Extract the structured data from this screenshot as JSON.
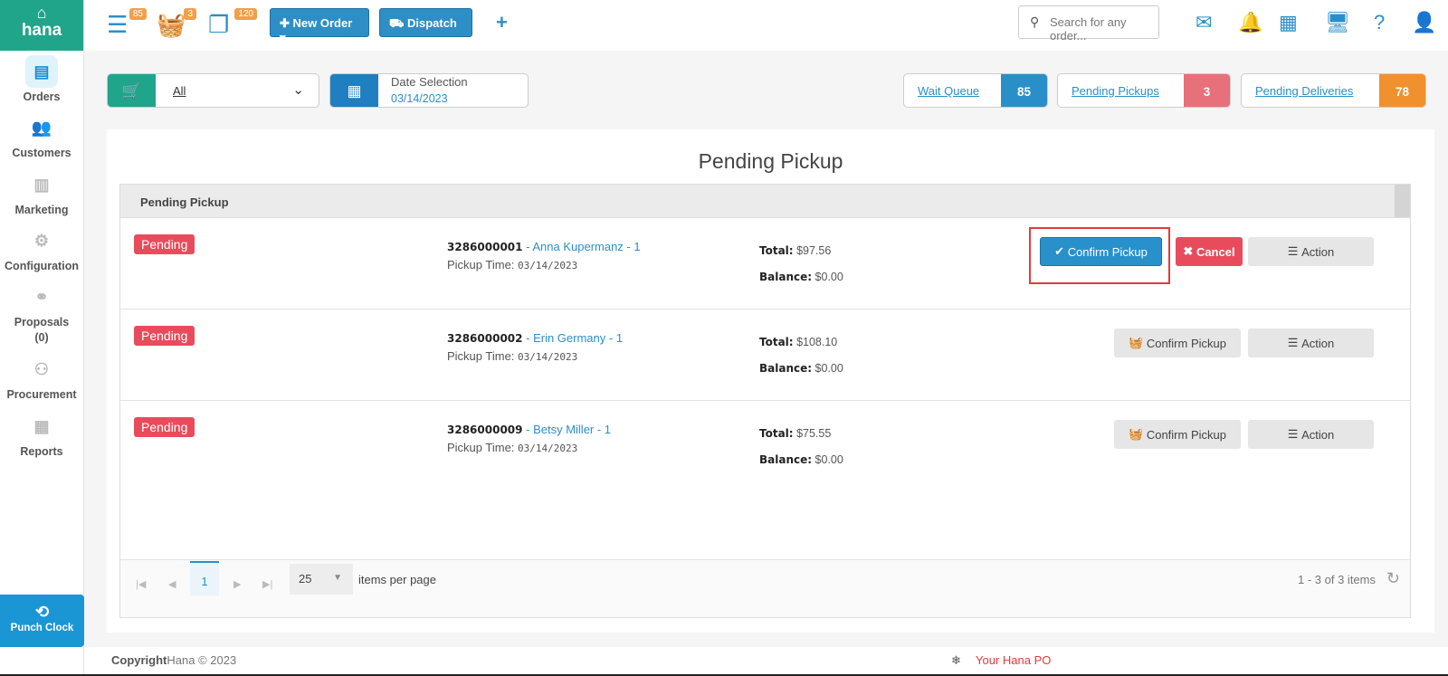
{
  "sidebar": {
    "brand": "hana",
    "items": [
      {
        "label": "Orders"
      },
      {
        "label": "Customers"
      },
      {
        "label": "Marketing"
      },
      {
        "label": "Configuration"
      },
      {
        "label": "Proposals",
        "sub": "(0)"
      },
      {
        "label": "Procurement"
      },
      {
        "label": "Reports"
      }
    ],
    "punch_clock": "Punch Clock"
  },
  "topbar": {
    "badges": {
      "queue": "85",
      "basket": "3",
      "copies": "120"
    },
    "new_order": "New Order",
    "dispatch": "Dispatch",
    "search_placeholder": "Search for any order..."
  },
  "filters": {
    "store": "All",
    "date_label": "Date Selection",
    "date_value": "03/14/2023",
    "counters": [
      {
        "label": "Wait Queue",
        "value": "85",
        "color": "#2a8fc9"
      },
      {
        "label": "Pending Pickups",
        "value": "3",
        "color": "#e8707a"
      },
      {
        "label": "Pending Deliveries",
        "value": "78",
        "color": "#f0912e"
      }
    ]
  },
  "panel": {
    "title": "Pending Pickup",
    "grid_header": "Pending Pickup",
    "rows": [
      {
        "status": "Pending",
        "order_id": "3286000001",
        "customer": "Anna Kupermanz - 1",
        "pickup_label": "Pickup Time:",
        "pickup_time": "03/14/2023",
        "total_label": "Total:",
        "total": "$97.56",
        "balance_label": "Balance:",
        "balance": "$0.00",
        "confirm": "Confirm Pickup",
        "cancel": "Cancel",
        "action": "Action"
      },
      {
        "status": "Pending",
        "order_id": "3286000002",
        "customer": "Erin Germany - 1",
        "pickup_label": "Pickup Time:",
        "pickup_time": "03/14/2023",
        "total_label": "Total:",
        "total": "$108.10",
        "balance_label": "Balance:",
        "balance": "$0.00",
        "confirm": "Confirm Pickup",
        "action": "Action"
      },
      {
        "status": "Pending",
        "order_id": "3286000009",
        "customer": "Betsy Miller - 1",
        "pickup_label": "Pickup Time:",
        "pickup_time": "03/14/2023",
        "total_label": "Total:",
        "total": "$75.55",
        "balance_label": "Balance:",
        "balance": "$0.00",
        "confirm": "Confirm Pickup",
        "action": "Action"
      }
    ],
    "pager": {
      "page": "1",
      "per_page": "25",
      "items_per_page": "items per page",
      "range": "1 - 3 of 3 items"
    }
  },
  "footer": {
    "copyright_bold": "Copyright",
    "copyright_rest": "Hana © 2023",
    "promo": "Your Hana PO"
  }
}
